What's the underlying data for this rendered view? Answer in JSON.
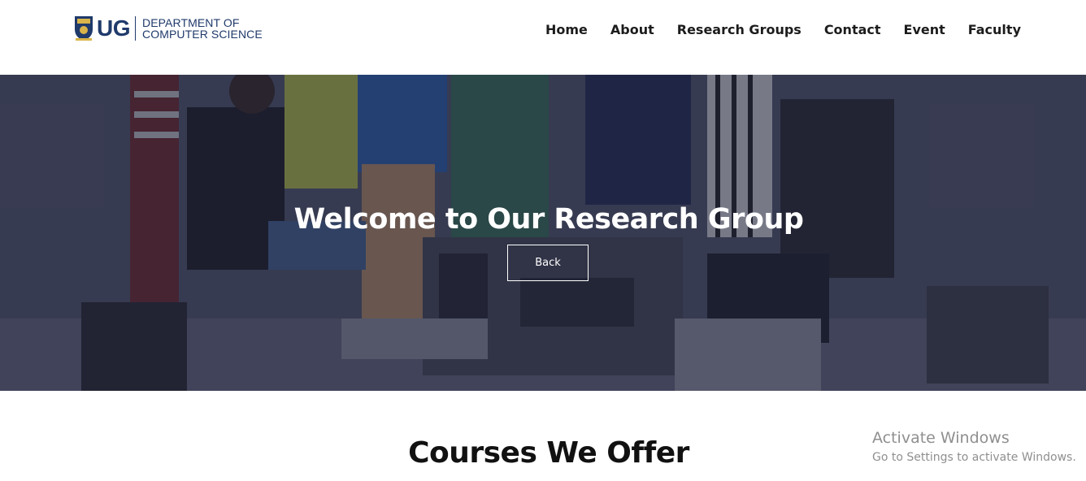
{
  "logo": {
    "short": "UG",
    "dept_line1": "DEPARTMENT OF",
    "dept_line2": "COMPUTER SCIENCE"
  },
  "nav": {
    "items": [
      "Home",
      "About",
      "Research Groups",
      "Contact",
      "Event",
      "Faculty"
    ]
  },
  "hero": {
    "title": "Welcome to Our Research Group",
    "back_label": "Back"
  },
  "section": {
    "title": "Courses We Offer"
  },
  "os_watermark": {
    "line1": "Activate Windows",
    "line2": "Go to Settings to activate Windows."
  },
  "colors": {
    "brand": "#1f3a6b",
    "overlay": "#1c1f38",
    "text_dark": "#1c1c1c"
  }
}
